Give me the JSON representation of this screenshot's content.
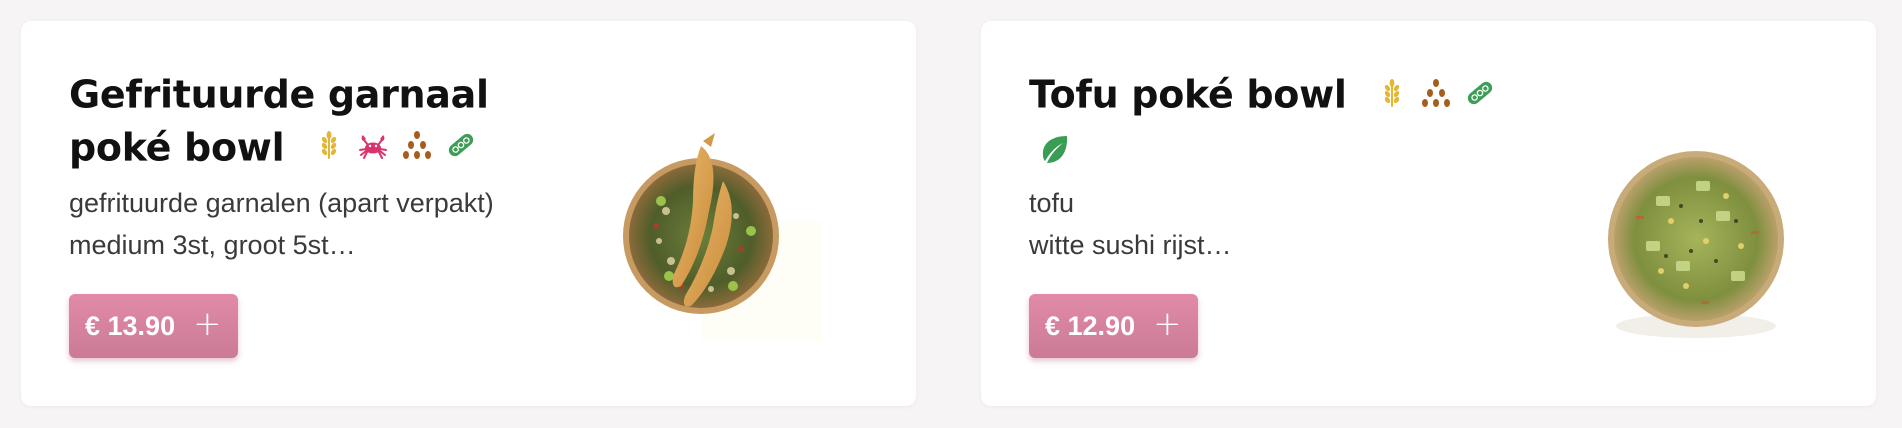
{
  "items": [
    {
      "title_line1": "Gefrituurde garnaal",
      "title_line2": "poké bowl",
      "description_line1": "gefrituurde garnalen (apart verpakt)",
      "description_line2": "medium 3st, groot 5st…",
      "price": "€ 13.90",
      "add_icon": "+",
      "icons": [
        "wheat-icon",
        "crab-icon",
        "sesame-icon",
        "soy-icon"
      ],
      "photo": "shrimp-poke-bowl-photo"
    },
    {
      "title_line1": "Tofu poké bowl",
      "description_line1": "tofu",
      "description_line2": "witte sushi rijst…",
      "price": "€ 12.90",
      "add_icon": "+",
      "icons": [
        "wheat-icon",
        "sesame-icon",
        "soy-icon",
        "leaf-icon"
      ],
      "photo": "tofu-poke-bowl-photo"
    }
  ],
  "colors": {
    "page_background": "#f6f4f5",
    "card_background": "#ffffff",
    "button": "#d9849f",
    "wheat": "#e4b634",
    "crab": "#d9336f",
    "sesame": "#a65e1c",
    "soy": "#3e9e57",
    "leaf": "#3a9d56"
  }
}
